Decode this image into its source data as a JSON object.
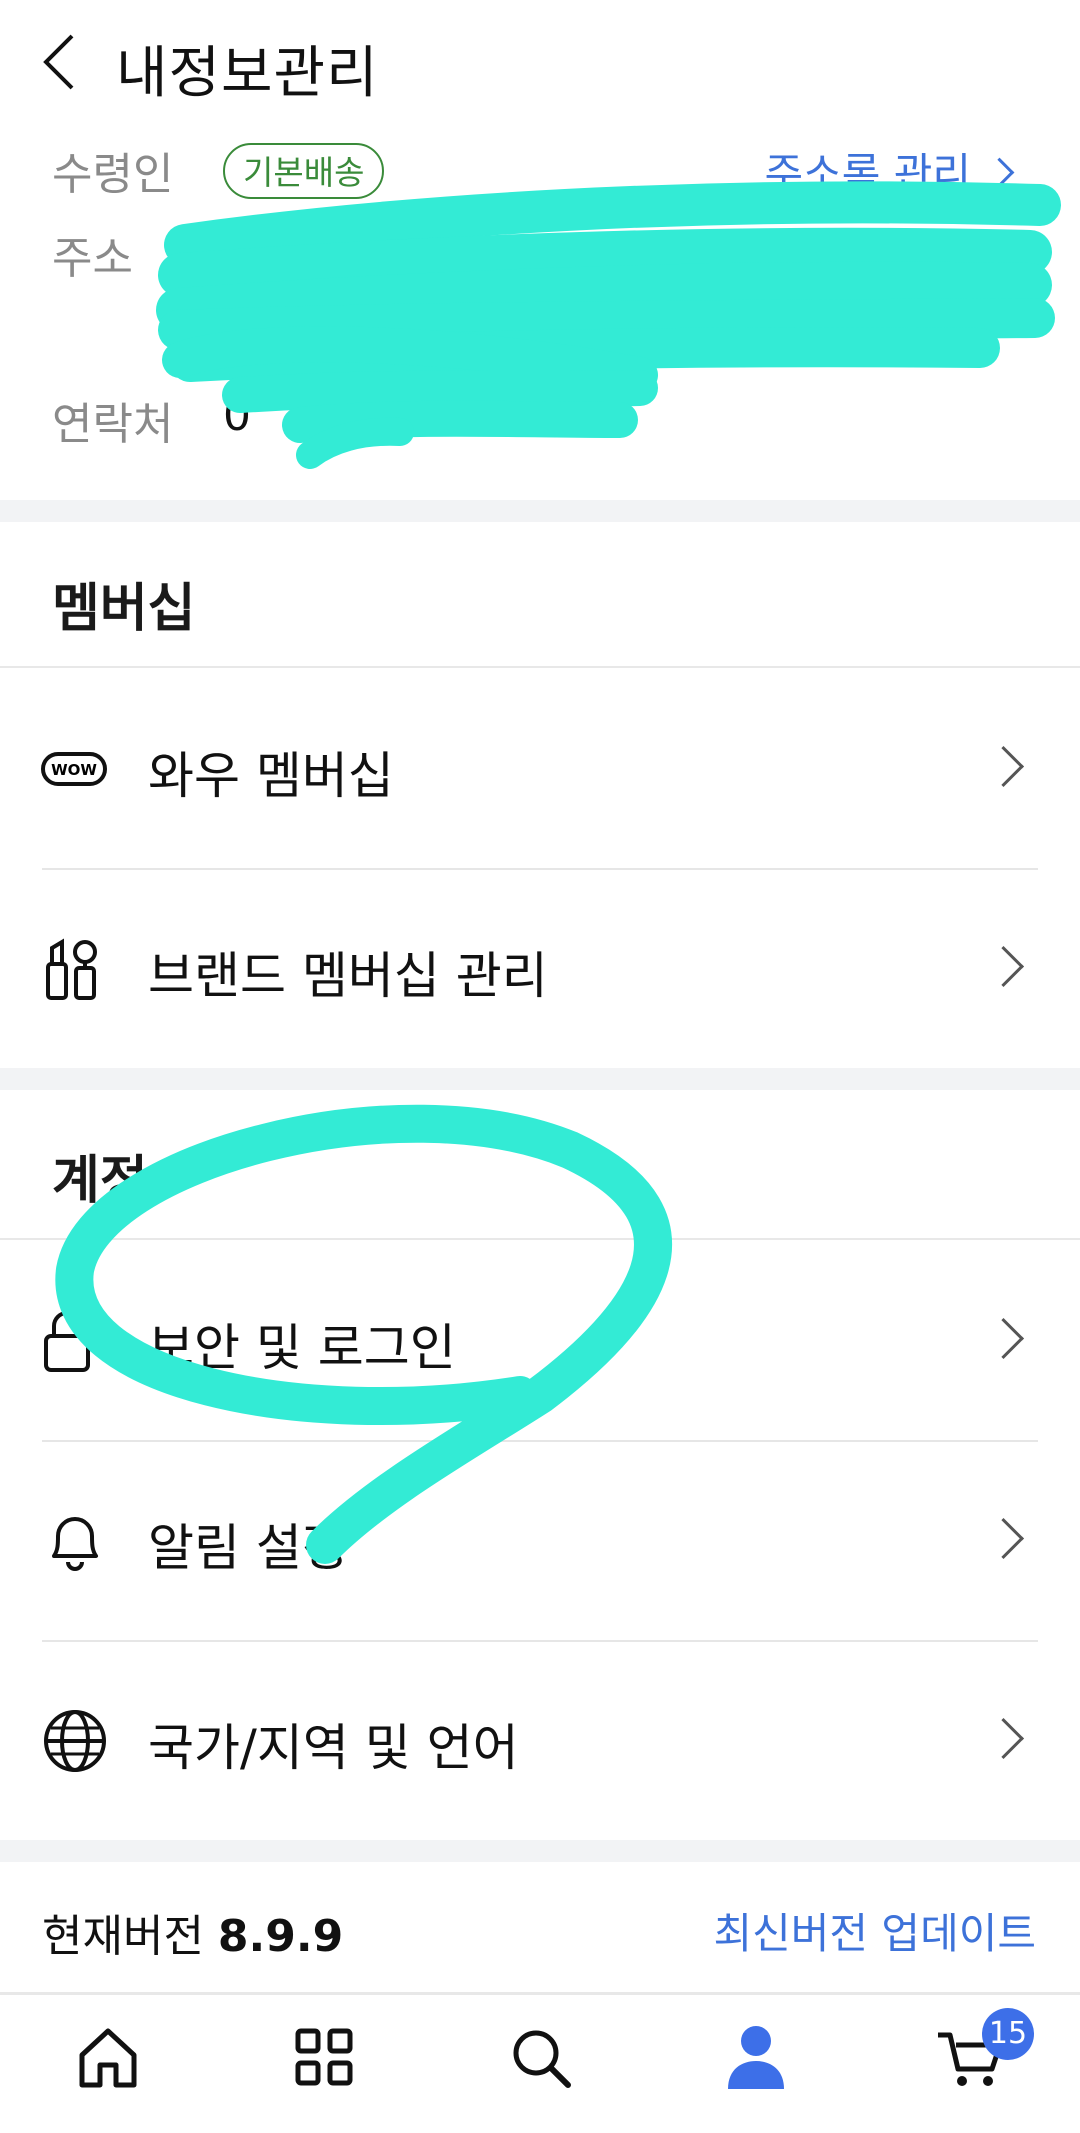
{
  "header": {
    "title": "내정보관리",
    "back_icon": "chevron-left-icon"
  },
  "address": {
    "recipient_label": "수령인",
    "default_badge": "기본배송",
    "manage_link": "주소록 관리",
    "address_label": "주소",
    "contact_label": "연락처",
    "contact_value_visible": "0"
  },
  "membership": {
    "title": "멤버십",
    "items": [
      {
        "label": "와우 멤버십",
        "icon": "wow-icon"
      },
      {
        "label": "브랜드 멤버십 관리",
        "icon": "cosmetics-icon"
      }
    ]
  },
  "account": {
    "title": "계정",
    "items": [
      {
        "label": "보안 및 로그인",
        "icon": "lock-icon"
      },
      {
        "label": "알림 설정",
        "icon": "bell-icon"
      },
      {
        "label": "국가/지역 및 언어",
        "icon": "globe-icon"
      }
    ]
  },
  "version": {
    "label": "현재버전",
    "number": "8.9.9",
    "update_link": "최신버전 업데이트"
  },
  "tabbar": {
    "tabs": [
      {
        "name": "home",
        "icon": "home-icon"
      },
      {
        "name": "category",
        "icon": "grid-icon"
      },
      {
        "name": "search",
        "icon": "search-icon"
      },
      {
        "name": "my",
        "icon": "person-icon",
        "active": true
      },
      {
        "name": "cart",
        "icon": "cart-icon"
      }
    ],
    "cart_count": "15"
  },
  "colors": {
    "accent": "#3d72d9",
    "badge_green": "#3a8b3a",
    "scribble": "#33ebd5",
    "active_tab": "#3d6fe8"
  }
}
